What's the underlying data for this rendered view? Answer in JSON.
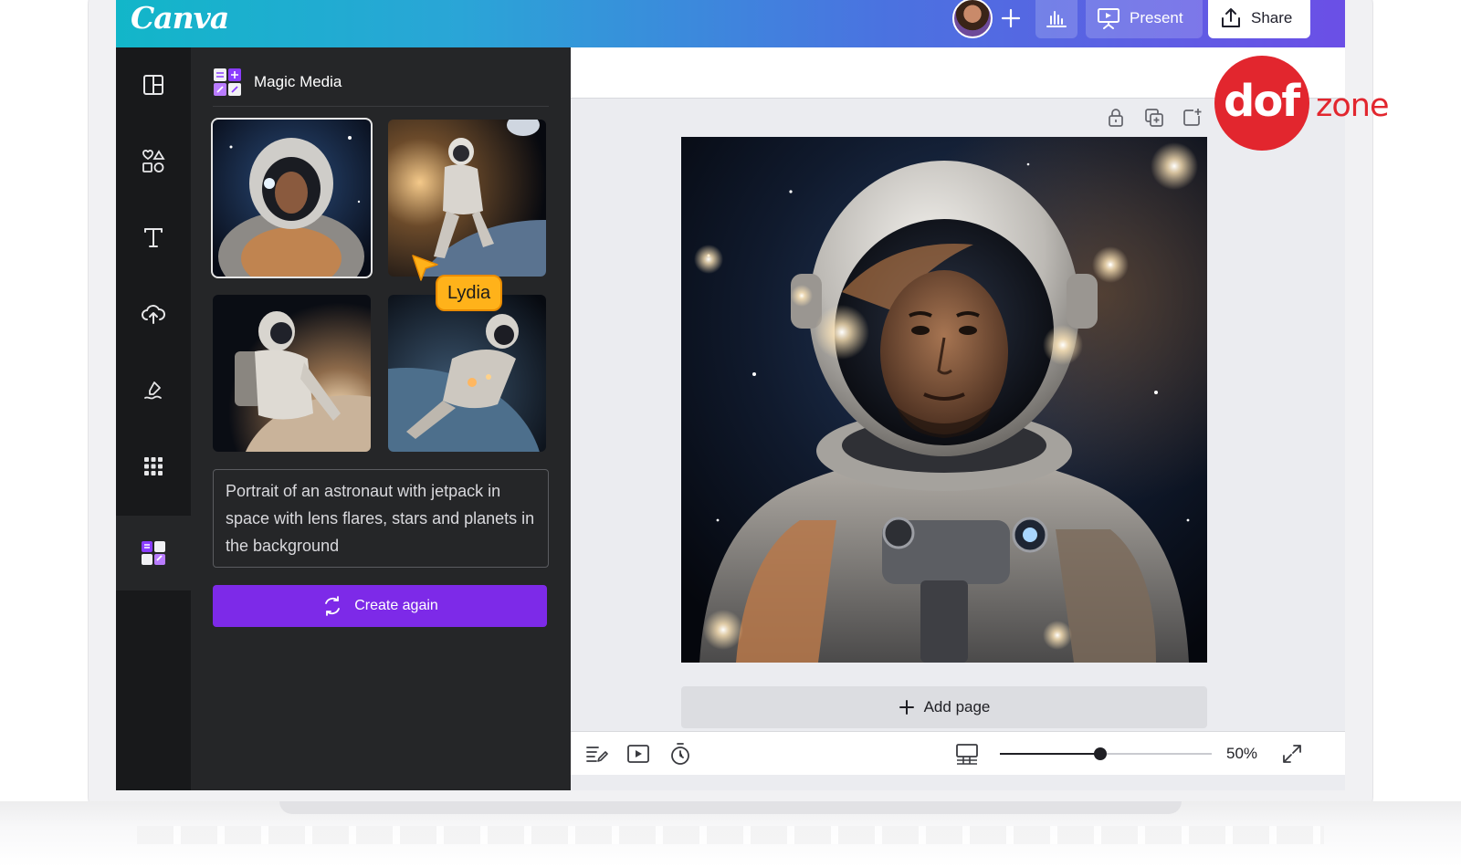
{
  "app": {
    "logo": "Canva"
  },
  "topbar": {
    "present_label": "Present",
    "share_label": "Share"
  },
  "rail": {
    "items": [
      "design-icon",
      "elements-icon",
      "text-icon",
      "uploads-icon",
      "draw-icon",
      "apps-icon",
      "magic-media-icon"
    ]
  },
  "panel": {
    "title": "Magic Media",
    "prompt": "Portrait of an astronaut with jetpack in space with lens flares, stars and planets in the background",
    "create_label": "Create again",
    "collaborator": "Lydia"
  },
  "canvas": {
    "add_page_label": "Add page",
    "zoom": "50%",
    "zoom_fraction": 0.5
  },
  "watermark": {
    "brand": "dof",
    "suffix": "zone"
  },
  "colors": {
    "accent": "#7d2ae8",
    "cursor": "#ffb21a",
    "watermark": "#e2262e"
  }
}
